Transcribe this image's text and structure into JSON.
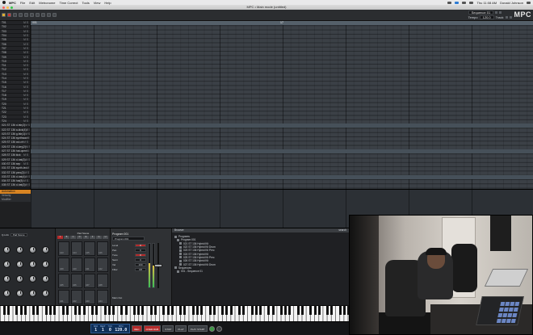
{
  "menubar": {
    "items": [
      "MPC",
      "File",
      "Edit",
      "Metronome",
      "Time Correct",
      "Tools",
      "View",
      "Help"
    ],
    "clock": "Thu 11:08 AM",
    "user": "Donald Johnson"
  },
  "window": {
    "title": "MPC • Main mode (untitled)"
  },
  "toolbar": {
    "tempo_label": "Tempo",
    "tempo_value": "120.0",
    "track_label": "Track",
    "sequence_label": "Sequence 01",
    "brand": "MPC"
  },
  "tracks": [
    {
      "name": "T01"
    },
    {
      "name": "T02"
    },
    {
      "name": "T03"
    },
    {
      "name": "T04"
    },
    {
      "name": "T05"
    },
    {
      "name": "T06"
    },
    {
      "name": "T07"
    },
    {
      "name": "T08"
    },
    {
      "name": "T09"
    },
    {
      "name": "T10"
    },
    {
      "name": "T11"
    },
    {
      "name": "T12"
    },
    {
      "name": "T13"
    },
    {
      "name": "T14"
    },
    {
      "name": "T15"
    },
    {
      "name": "T16"
    },
    {
      "name": "T17"
    },
    {
      "name": "T18"
    },
    {
      "name": "T19"
    },
    {
      "name": "T20"
    },
    {
      "name": "T21"
    },
    {
      "name": "T22"
    },
    {
      "name": "T23"
    },
    {
      "name": "T24"
    },
    {
      "name": "021 ST 136 d-fsh(2)"
    },
    {
      "name": "022 ST 136 a-kick(4)"
    },
    {
      "name": "023 ST 136 g-fsh(1)"
    },
    {
      "name": "024 ST 136 synthwav"
    },
    {
      "name": "025 ST 136 cut-ch"
    },
    {
      "name": "026 ST 136 d-key(2)"
    },
    {
      "name": "027 ST 136 hat-open"
    },
    {
      "name": "028 ST 136 kick"
    },
    {
      "name": "029 ST 136 d-hat(3)"
    },
    {
      "name": "030 ST 136 sep"
    },
    {
      "name": "031 ST 136 synth-leo"
    },
    {
      "name": "032 ST 136 perc(2)"
    },
    {
      "name": "033 ST 136 d-hat(4)"
    },
    {
      "name": "034 ST 136 hat(5)"
    },
    {
      "name": "035 ST 136 d-hat(3)"
    }
  ],
  "track_mute_label": "M S",
  "ruler": {
    "start": "001",
    "marker": "17"
  },
  "lower_lanes": [
    "Automation",
    "Velocity",
    "Modifier"
  ],
  "knob_panel": {
    "label_a": "Q-Link",
    "mode": "Pad Scene",
    "knobs_count": 16
  },
  "pads": {
    "title": "Pad Scene",
    "banks": [
      "A",
      "B",
      "C",
      "D",
      "E",
      "F",
      "G",
      "H"
    ],
    "active_bank": "A",
    "pad_labels": [
      "A13",
      "A14",
      "A15",
      "A16",
      "A09",
      "A10",
      "A11",
      "A12",
      "A05",
      "A06",
      "A07",
      "A08",
      "A01",
      "A02",
      "A03",
      "A04"
    ]
  },
  "program": {
    "title": "Program 001",
    "selector": "Program 001",
    "params": [
      {
        "name": "Level",
        "value": "0"
      },
      {
        "name": "Pan",
        "value": "C"
      },
      {
        "name": "Tune",
        "value": "0"
      },
      {
        "name": "Semi",
        "value": "0"
      },
      {
        "name": "Vel",
        "value": "100"
      },
      {
        "name": "Filter",
        "value": "Off"
      }
    ],
    "meter_level": 0.55,
    "output_label": "Main Out"
  },
  "browser": {
    "title": "Browser",
    "search_label": "search",
    "tree": [
      {
        "label": "Programs",
        "indent": 0
      },
      {
        "label": "Program 001",
        "indent": 1
      },
      {
        "label": "021 ST 136 Hybrid Kit",
        "indent": 2
      },
      {
        "label": "022 ST 136 Hybrid Kit Drum",
        "indent": 2
      },
      {
        "label": "023 ST 136 Hybrid Kit Perc",
        "indent": 2
      },
      {
        "label": "024 ST 136 Hybrid Kit",
        "indent": 2
      },
      {
        "label": "025 ST 136 Hybrid Kit Perc",
        "indent": 2
      },
      {
        "label": "026 ST 136 Hybrid Kit",
        "indent": 2
      },
      {
        "label": "027 ST 136 Hybrid Kit Drum",
        "indent": 2
      },
      {
        "label": "Sequences",
        "indent": 0
      },
      {
        "label": "001 - Sequence 01",
        "indent": 1
      }
    ]
  },
  "transport": {
    "bars_cap": "BAR",
    "beats_cap": "BEAT",
    "ticks_cap": "TICK",
    "tempo_cap": "BPM",
    "bar": "1",
    "beat": "1",
    "tick": "0",
    "tempo": "120.0",
    "buttons": [
      "REC",
      "OVER DUB",
      "STOP",
      "PLAY",
      "PLAY START"
    ]
  },
  "colors": {
    "accent": "#d88422",
    "record": "#b32a2a",
    "lcd": "#0f2f58",
    "grid": "#3b4046"
  }
}
